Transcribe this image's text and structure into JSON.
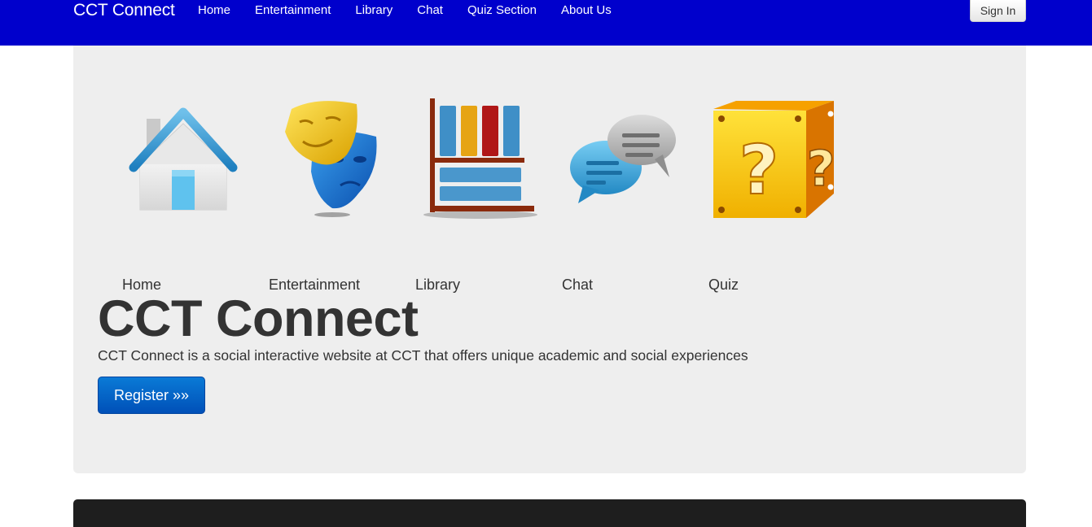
{
  "navbar": {
    "brand": "CCT Connect",
    "links": [
      "Home",
      "Entertainment",
      "Library",
      "Chat",
      "Quiz Section",
      "About Us"
    ],
    "signin_label": "Sign In",
    "color": "#0000cc"
  },
  "tiles": [
    {
      "label": "Home",
      "icon": "house-icon"
    },
    {
      "label": "Entertainment",
      "icon": "theater-masks-icon"
    },
    {
      "label": "Library",
      "icon": "bookshelf-icon"
    },
    {
      "label": "Chat",
      "icon": "chat-bubbles-icon"
    },
    {
      "label": "Quiz",
      "icon": "question-block-icon"
    }
  ],
  "hero": {
    "title": "CCT Connect",
    "description": "CCT Connect is a social interactive website at CCT that offers unique academic and social experiences",
    "register_label": "Register »»"
  }
}
